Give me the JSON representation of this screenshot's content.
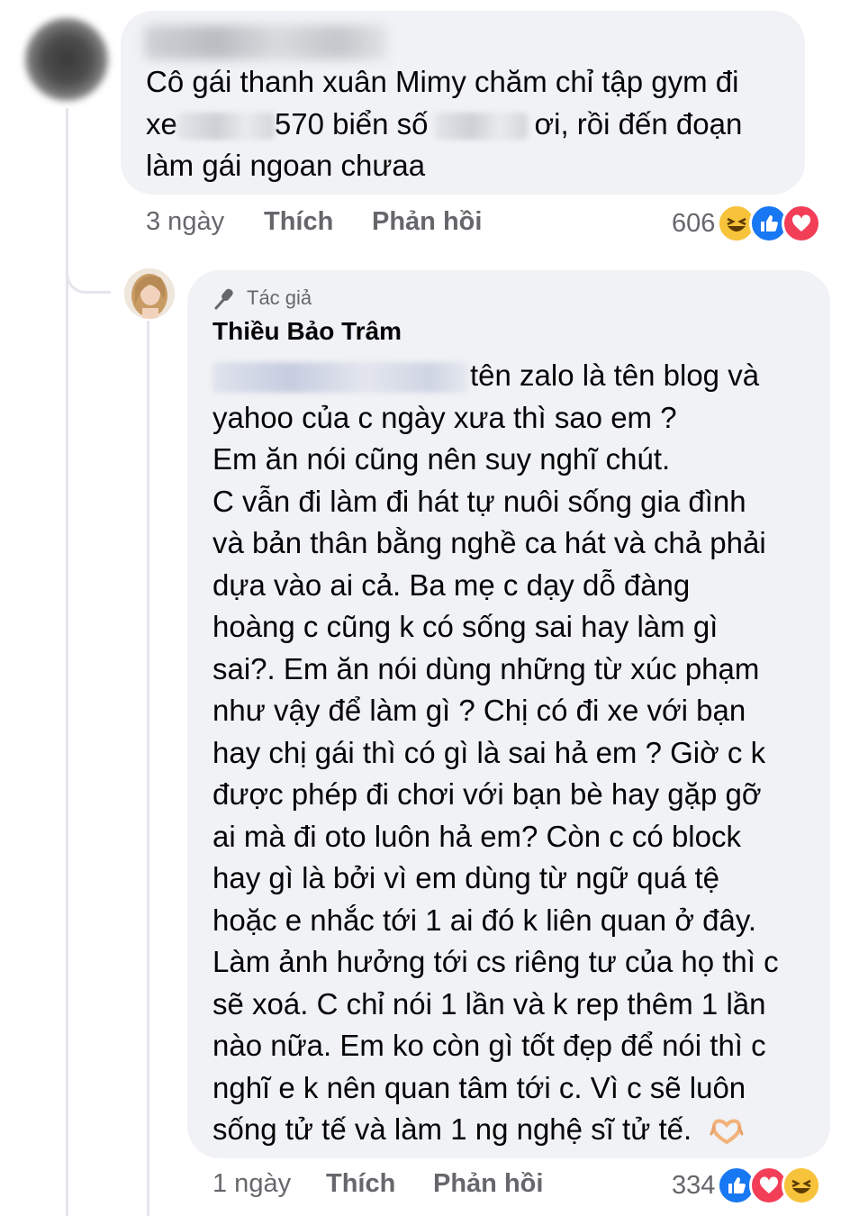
{
  "comment1": {
    "text_parts": [
      "Cô gái thanh xuân Mimy chăm chỉ tập gym đi",
      "xe",
      "570 biển số",
      "ơi, rồi đến đoạn",
      "làm gái ngoan chưaa"
    ],
    "time": "3 ngày",
    "like_label": "Thích",
    "reply_label": "Phản hồi",
    "reaction_count": "606",
    "reactions": [
      "haha",
      "like",
      "love"
    ]
  },
  "reply": {
    "badge_label": "Tác giả",
    "author_name": "Thiều Bảo Trâm",
    "lines": [
      "tên zalo là tên blog và",
      "yahoo của c ngày xưa thì sao em ?",
      "Em ăn nói cũng nên suy nghĩ chút.",
      "C vẫn đi làm đi hát tự nuôi sống gia đình",
      "và bản thân bằng nghề ca hát và chả phải",
      "dựa vào ai cả. Ba mẹ c dạy dỗ đàng",
      "hoàng c cũng k có sống sai hay làm gì",
      "sai?. Em ăn nói dùng những từ xúc phạm",
      "như vậy để làm gì ? Chị có đi xe với bạn",
      "hay chị gái thì có gì là sai hả em ? Giờ c k",
      "được phép đi chơi với bạn bè hay gặp gỡ",
      "ai mà đi oto luôn hả em? Còn c có block",
      "hay gì là bởi vì em dùng từ ngữ quá tệ",
      "hoặc e nhắc tới 1 ai đó k liên quan ở đây.",
      "Làm ảnh hưởng tới cs riêng tư của họ thì c",
      "sẽ xoá. C chỉ nói 1 lần và k rep thêm 1 lần",
      "nào nữa. Em ko còn gì tốt đẹp để nói thì c",
      "nghĩ e k nên quan tâm tới c. Vì c sẽ luôn",
      "sống tử tế và làm 1 ng nghệ sĩ tử tế."
    ],
    "end_emoji": "heart-hands-emoji",
    "time": "1 ngày",
    "like_label": "Thích",
    "reply_label": "Phản hồi",
    "reaction_count": "334",
    "reactions": [
      "like",
      "love",
      "haha"
    ]
  },
  "colors": {
    "bubble": "#f0f2f5",
    "meta_text": "#65676b",
    "like_blue": "#1877f2",
    "love_red": "#f33e58",
    "haha_yellow": "#f7c33b"
  }
}
